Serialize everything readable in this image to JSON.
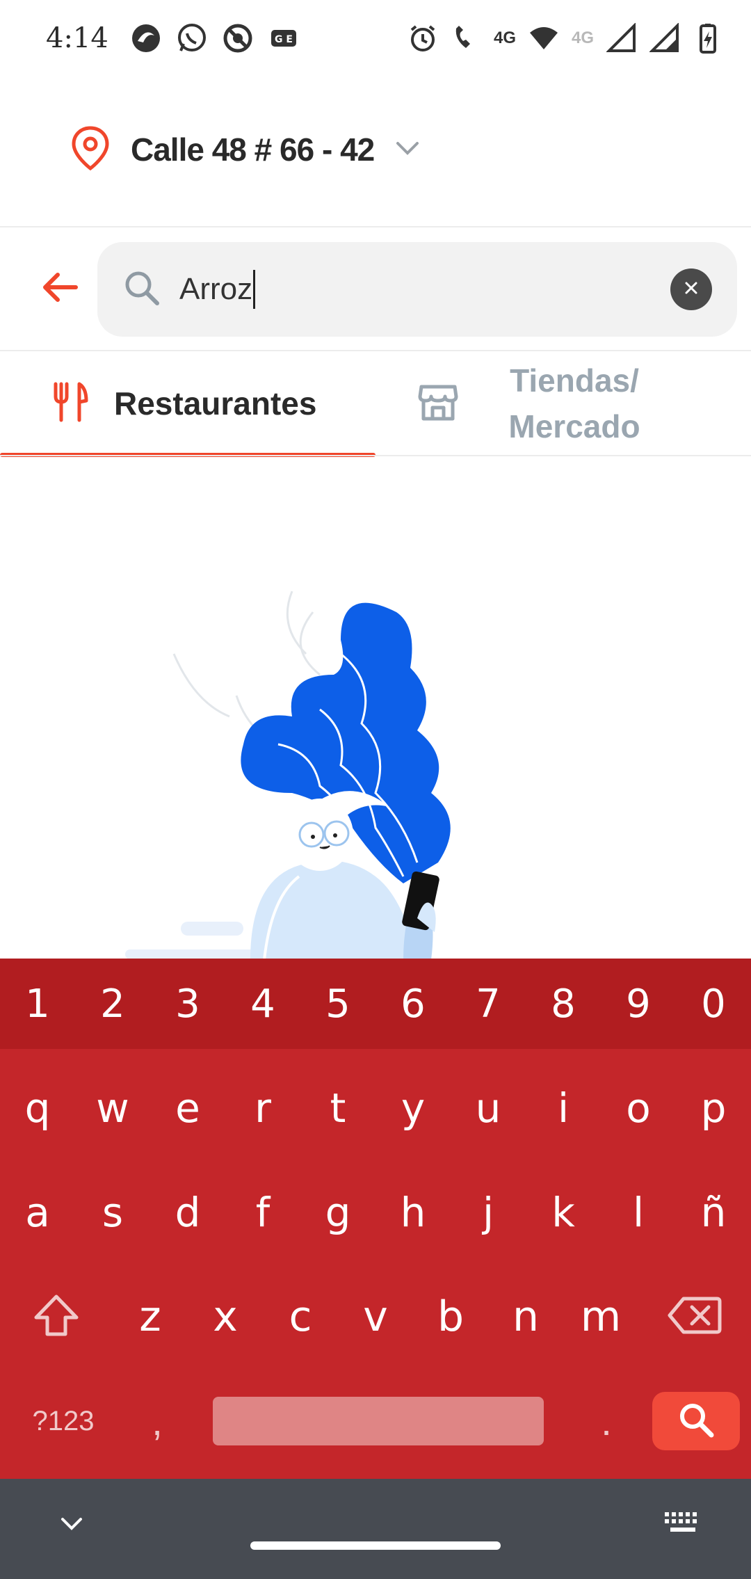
{
  "status_bar": {
    "time": "4:14",
    "network_label": "4G",
    "network_label_secondary": "4G",
    "icons_left": [
      "browser-icon",
      "whatsapp-icon",
      "circle-app-icon",
      "gmail-sim-icon"
    ],
    "icons_right": [
      "alarm-icon",
      "volte-call-icon",
      "wifi-icon",
      "signal-icon",
      "signal-icon",
      "battery-charging-icon"
    ]
  },
  "header": {
    "address": "Calle 48 # 66 - 42"
  },
  "search": {
    "value": "Arroz"
  },
  "tabs": [
    {
      "label": "Restaurantes",
      "active": true
    },
    {
      "label_line1": "Tiendas/",
      "label_line2": "Mercado",
      "active": false
    }
  ],
  "keyboard": {
    "numbers": [
      "1",
      "2",
      "3",
      "4",
      "5",
      "6",
      "7",
      "8",
      "9",
      "0"
    ],
    "row1": [
      "q",
      "w",
      "e",
      "r",
      "t",
      "y",
      "u",
      "i",
      "o",
      "p"
    ],
    "row2": [
      "a",
      "s",
      "d",
      "f",
      "g",
      "h",
      "j",
      "k",
      "l",
      "ñ"
    ],
    "row3": [
      "z",
      "x",
      "c",
      "v",
      "b",
      "n",
      "m"
    ],
    "symbols_label": "?123",
    "comma": ",",
    "period": "."
  },
  "colors": {
    "accent": "#f0462b",
    "keyboard_bg": "#c4262a",
    "keyboard_numrow": "#b11d20",
    "illustration_blue": "#0d5fe8"
  }
}
